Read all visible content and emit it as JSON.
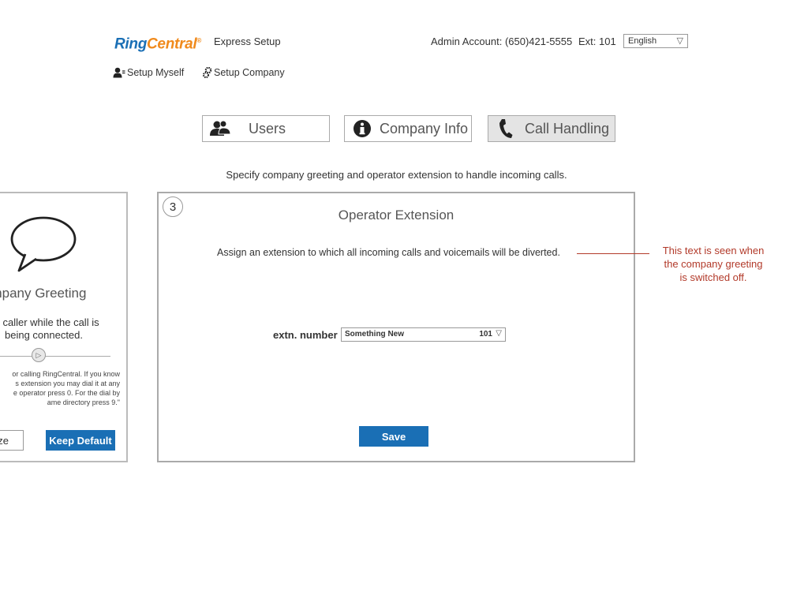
{
  "header": {
    "logo_ring": "Ring",
    "logo_central": "Central",
    "product": "Express Setup",
    "admin_account": "Admin Account: (650)421-5555",
    "extension": "Ext: 101",
    "language": "English"
  },
  "setup_links": {
    "myself": "Setup Myself",
    "company": "Setup Company"
  },
  "tabs": [
    {
      "label": "Users",
      "icon": "users-icon",
      "active": false
    },
    {
      "label": "Company Info",
      "icon": "info-icon",
      "active": false
    },
    {
      "label": "Call Handling",
      "icon": "phone-icon",
      "active": true
    }
  ],
  "instruction": "Specify company greeting and operator extension to handle incoming calls.",
  "greeting_card": {
    "title": "ompany Greeting",
    "text_line1": "he caller while the call is",
    "text_line2": "being connected.",
    "quote_line1": "or calling RingCentral. If you know",
    "quote_line2": "s extension you may dial it at any",
    "quote_line3": "e operator press 0. For the dial by",
    "quote_line4": "ame directory press 9.\"",
    "customize_label": "nize",
    "keep_default_label": "Keep Default"
  },
  "operator_card": {
    "step": "3",
    "title": "Operator Extension",
    "description": "Assign an extension to which all incoming calls and voicemails will be diverted.",
    "extn_label": "extn. number",
    "selected_name": "Something New",
    "selected_number": "101",
    "save_label": "Save"
  },
  "annotation": {
    "line1": "This text is seen when",
    "line2": "the company greeting",
    "line3": "is switched off."
  },
  "colors": {
    "brand_blue": "#1a6fb5",
    "brand_orange": "#f08a1c",
    "annotation_red": "#b23a2a"
  }
}
